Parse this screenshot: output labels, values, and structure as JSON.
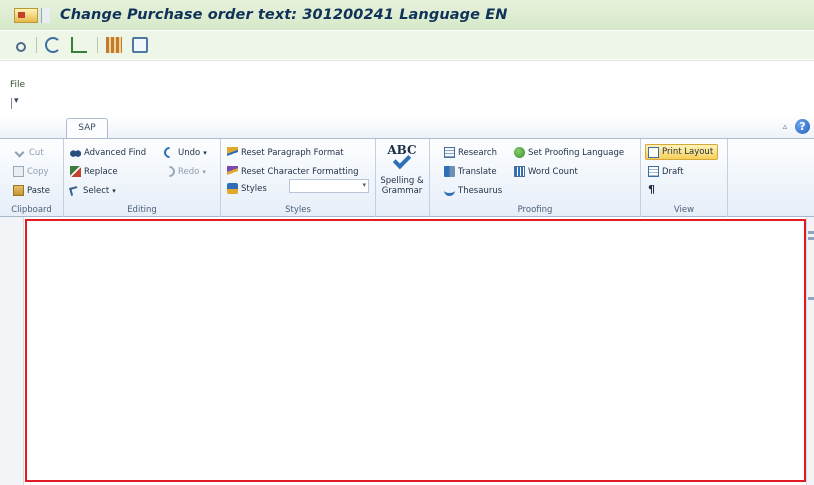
{
  "window": {
    "title": "Change Purchase order text: 301200241 Language EN",
    "title_icon": "sap-window-icon",
    "background_color": "#d6e8c8",
    "title_color": "#103258"
  },
  "sap_toolbar": {
    "icons": [
      "display-icon",
      "refresh-icon",
      "tree-structure-icon",
      "grid-icon",
      "document-icon"
    ]
  },
  "menu": {
    "file_label": "File"
  },
  "quick_access": {
    "customize_glyph": "▾"
  },
  "ribbon": {
    "tabs": [
      "SAP"
    ],
    "active_tab": "SAP",
    "groups": {
      "clipboard": {
        "label": "Clipboard",
        "cut": "Cut",
        "copy": "Copy",
        "paste": "Paste"
      },
      "editing": {
        "label": "Editing",
        "advanced_find": "Advanced Find",
        "replace": "Replace",
        "select": "Select",
        "undo": "Undo",
        "redo": "Redo"
      },
      "styles": {
        "label": "Styles",
        "reset_paragraph": "Reset Paragraph Format",
        "reset_character": "Reset Character Formatting",
        "styles": "Styles",
        "styles_value": ""
      },
      "spelling": {
        "abc": "ABC",
        "label": "Spelling & Grammar"
      },
      "proofing": {
        "label": "Proofing",
        "research": "Research",
        "set_proofing_language": "Set Proofing Language",
        "translate": "Translate",
        "word_count": "Word Count",
        "thesaurus": "Thesaurus"
      },
      "view": {
        "label": "View",
        "print_layout": "Print Layout",
        "draft": "Draft",
        "pilcrow": "¶"
      }
    }
  },
  "document": {
    "highlight_color": "#e01b24",
    "content": ""
  }
}
